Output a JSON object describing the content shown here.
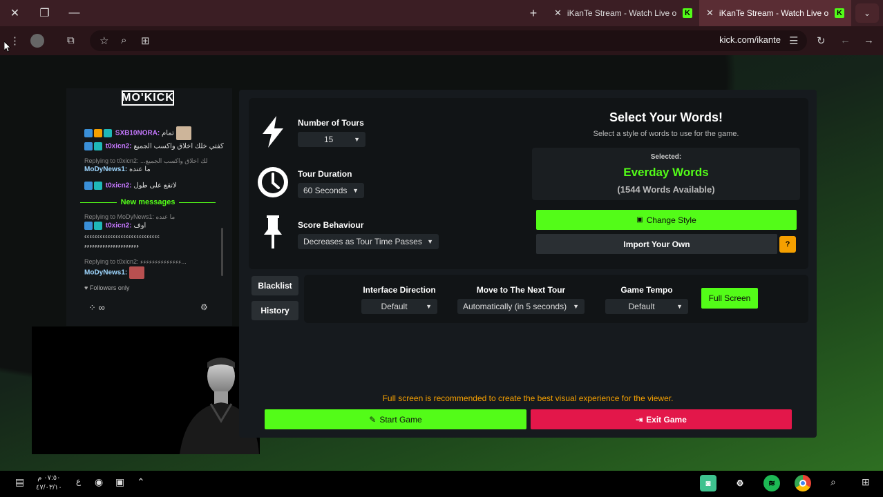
{
  "browser": {
    "tabs": [
      {
        "label": "iKanTe Stream - Watch Live on Kick",
        "active": false
      },
      {
        "label": "iKanTe Stream - Watch Live on Kick",
        "active": true
      }
    ],
    "url": "kick.com/ikante"
  },
  "chat": {
    "logo": "MO'KICK",
    "messages": [
      {
        "user": "SXB10NORA:",
        "text": "تمام",
        "user_color": "#c678ff"
      },
      {
        "user": "t0xicn2:",
        "text": "كفتي خلك اخلاق واكسب الجميع",
        "user_color": "#c678ff"
      },
      {
        "reply": "Replying to t0xicn2: ...لك اخلاق واكسب الجميع",
        "user": "MoDyNews1:",
        "text": "ما عنده",
        "user_color": "#9fd7ff"
      },
      {
        "user": "t0xicn2:",
        "text": "لاتقع على طول",
        "user_color": "#c678ff"
      }
    ],
    "new_messages_label": "New messages",
    "messages_after": [
      {
        "reply": "Replying to MoDyNews1: ما عنده",
        "user": "t0xicn2:",
        "text": "اوف",
        "user_color": "#c678ff"
      },
      {
        "text": "ءءءءءءءءءءءءءءءءءءءءءءءءءءءءء"
      },
      {
        "text": "ءءءءءءءءءءءءءءءءءءءءء"
      },
      {
        "reply": "Replying to t0xicn2: ءءءءءءءءءءءءءء...",
        "user": "MoDyNews1:",
        "text": "",
        "user_color": "#9fd7ff"
      }
    ],
    "followers_only": "Followers only",
    "footer_symbol": "∞"
  },
  "game": {
    "number_of_tours": {
      "label": "Number of Tours",
      "value": "15"
    },
    "tour_duration": {
      "label": "Tour Duration",
      "value": "60 Seconds"
    },
    "score_behaviour": {
      "label": "Score Behaviour",
      "value": "Decreases as Tour Time Passes"
    },
    "words": {
      "title": "Select Your Words!",
      "subtitle": "Select a style of words to use for the game.",
      "selected_label": "Selected:",
      "selected_value": "Everday Words",
      "available": "(1544 Words Available)"
    },
    "change_style": "Change Style",
    "import_own": "Import Your Own",
    "help_glyph": "?",
    "blacklist": "Blacklist",
    "history": "History",
    "interface_direction": {
      "label": "Interface Direction",
      "value": "Default"
    },
    "next_tour": {
      "label": "Move to The Next Tour",
      "value": "Automatically (in 5 seconds)"
    },
    "game_tempo": {
      "label": "Game Tempo",
      "value": "Default"
    },
    "full_screen": "Full Screen",
    "notice": "Full screen is recommended to create the best visual experience for the viewer.",
    "start_game": "Start Game",
    "exit_game": "Exit Game"
  },
  "taskbar": {
    "time": "٠٧:٥٠ م",
    "date": "٤٧/٠٣/١٠",
    "lang": "ع"
  },
  "colors": {
    "kick_green": "#53fc18",
    "exit_red": "#e3174a",
    "warn_orange": "#f5a000"
  }
}
